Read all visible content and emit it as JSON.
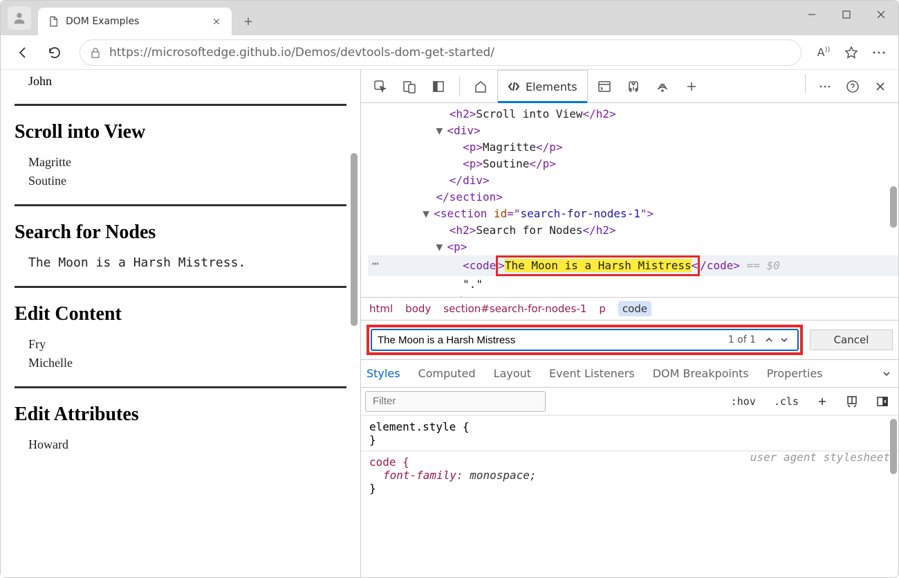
{
  "browser": {
    "tab_title": "DOM Examples",
    "url_display": "https://microsoftedge.github.io/Demos/devtools-dom-get-started/"
  },
  "page": {
    "top_names": [
      "John"
    ],
    "sections": [
      {
        "heading": "Scroll into View",
        "items": [
          "Magritte",
          "Soutine"
        ]
      },
      {
        "heading": "Search for Nodes",
        "code": "The Moon is a Harsh Mistress."
      },
      {
        "heading": "Edit Content",
        "items": [
          "Fry",
          "Michelle"
        ]
      },
      {
        "heading": "Edit Attributes",
        "items": [
          "Howard"
        ]
      }
    ]
  },
  "devtools": {
    "elements_tab": "Elements",
    "dom": {
      "h2_scroll": "Scroll into View",
      "p_magritte": "Magritte",
      "p_soutine": "Soutine",
      "section_attr_name": "id",
      "section_attr_val": "search-for-nodes-1",
      "h2_search": "Search for Nodes",
      "code_text": "The Moon is a Harsh Mistress",
      "period": "\".\""
    },
    "crumb": [
      "html",
      "body",
      "section#search-for-nodes-1",
      "p",
      "code"
    ],
    "search": {
      "query": "The Moon is a Harsh Mistress",
      "count": "1 of 1",
      "cancel": "Cancel"
    },
    "styles_tabs": [
      "Styles",
      "Computed",
      "Layout",
      "Event Listeners",
      "DOM Breakpoints",
      "Properties"
    ],
    "filter_placeholder": "Filter",
    "toolbar": {
      "hov": ":hov",
      "cls": ".cls"
    },
    "css": {
      "element_style": "element.style {",
      "close1": "}",
      "code_sel": "code {",
      "prop": "font-family",
      "val": "monospace;",
      "close2": "}",
      "uas": "user agent stylesheet"
    }
  }
}
